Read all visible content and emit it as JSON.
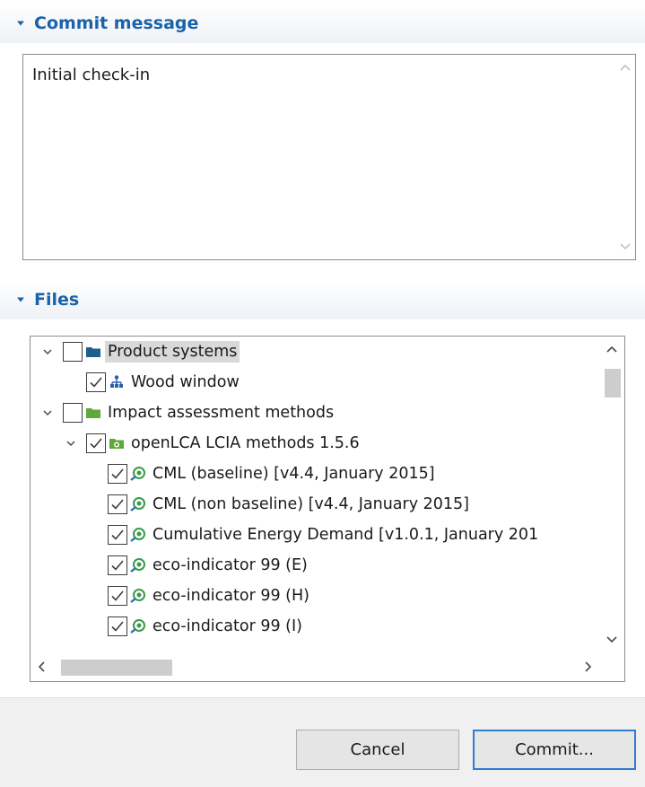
{
  "commit_section": {
    "title": "Commit message",
    "message": "Initial check-in"
  },
  "files_section": {
    "title": "Files",
    "tree": [
      {
        "label": "Product systems",
        "level": 0,
        "expanded": true,
        "checked": false,
        "icon": "folder-icon",
        "icon_color": "#1f5f8b",
        "selected": true
      },
      {
        "label": "Wood window",
        "level": 1,
        "expanded": null,
        "checked": true,
        "icon": "product-system-icon",
        "icon_color": "#2a5db0",
        "selected": false
      },
      {
        "label": "Impact assessment methods",
        "level": 0,
        "expanded": true,
        "checked": false,
        "icon": "folder-icon",
        "icon_color": "#5fa83a",
        "selected": false
      },
      {
        "label": "openLCA LCIA methods 1.5.6",
        "level": 1,
        "expanded": true,
        "checked": true,
        "icon": "method-folder-icon",
        "icon_color": "#5fa83a",
        "selected": false
      },
      {
        "label": "CML (baseline) [v4.4, January 2015]",
        "level": 2,
        "expanded": null,
        "checked": true,
        "icon": "impact-method-icon",
        "icon_color": "#3a9a4a",
        "selected": false
      },
      {
        "label": "CML (non baseline) [v4.4, January 2015]",
        "level": 2,
        "expanded": null,
        "checked": true,
        "icon": "impact-method-icon",
        "icon_color": "#3a9a4a",
        "selected": false
      },
      {
        "label": "Cumulative Energy Demand [v1.0.1, January 201",
        "level": 2,
        "expanded": null,
        "checked": true,
        "icon": "impact-method-icon",
        "icon_color": "#3a9a4a",
        "selected": false
      },
      {
        "label": "eco-indicator 99 (E)",
        "level": 2,
        "expanded": null,
        "checked": true,
        "icon": "impact-method-icon",
        "icon_color": "#3a9a4a",
        "selected": false
      },
      {
        "label": "eco-indicator 99 (H)",
        "level": 2,
        "expanded": null,
        "checked": true,
        "icon": "impact-method-icon",
        "icon_color": "#3a9a4a",
        "selected": false
      },
      {
        "label": "eco-indicator 99 (I)",
        "level": 2,
        "expanded": null,
        "checked": true,
        "icon": "impact-method-icon",
        "icon_color": "#3a9a4a",
        "selected": false
      }
    ]
  },
  "buttons": {
    "cancel": "Cancel",
    "commit": "Commit..."
  },
  "colors": {
    "section_title": "#1a63a8",
    "default_button_border": "#2f7dd1"
  }
}
